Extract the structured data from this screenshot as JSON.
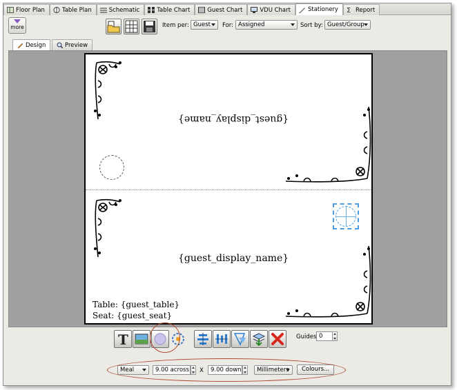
{
  "tabs": [
    {
      "label": "Floor Plan",
      "icon": "floor-plan-icon",
      "active": false
    },
    {
      "label": "Table Plan",
      "icon": "table-plan-icon",
      "active": false
    },
    {
      "label": "Schematic",
      "icon": "schematic-icon",
      "active": false
    },
    {
      "label": "Table Chart",
      "icon": "table-chart-icon",
      "active": false
    },
    {
      "label": "Guest Chart",
      "icon": "guest-chart-icon",
      "active": false
    },
    {
      "label": "VDU Chart",
      "icon": "vdu-chart-icon",
      "active": false
    },
    {
      "label": "Stationery",
      "icon": "stationery-icon",
      "active": true
    },
    {
      "label": "Report",
      "icon": "report-icon",
      "active": false
    }
  ],
  "toolbar": {
    "more_label": "more",
    "item_per_label": "Item per:",
    "item_per_value": "Guest",
    "for_label": "For:",
    "for_value": "Assigned",
    "sort_by_label": "Sort by:",
    "sort_by_value": "Guest/Group"
  },
  "view_tabs": [
    {
      "label": "Design",
      "icon": "pencil-icon",
      "active": true
    },
    {
      "label": "Preview",
      "icon": "magnifier-icon",
      "active": false
    }
  ],
  "card": {
    "top_text": "{guest_display_name}",
    "bottom_text": "{guest_display_name}",
    "table_text": "Table: {guest_table}",
    "seat_text": "Seat: {guest_seat}"
  },
  "bottom_tools": [
    {
      "name": "text-tool-icon"
    },
    {
      "name": "image-tool-icon"
    },
    {
      "name": "circle-tool-icon"
    },
    {
      "name": "shape-settings-icon"
    },
    {
      "name": "align-center-icon"
    },
    {
      "name": "distribute-icon"
    },
    {
      "name": "transform-icon"
    },
    {
      "name": "layers-down-icon"
    },
    {
      "name": "delete-icon"
    }
  ],
  "guides": {
    "label": "Guides:",
    "value": "0"
  },
  "paper": {
    "type_value": "Meal",
    "across_value": "9.00 across",
    "x_label": "X",
    "down_value": "9.00 down",
    "units_value": "Millimeters",
    "colours_label": "Colours..."
  },
  "colors": {
    "highlight": "#b0442e",
    "selection": "#4d9de0",
    "canvas_bg": "#a0a0a0"
  }
}
